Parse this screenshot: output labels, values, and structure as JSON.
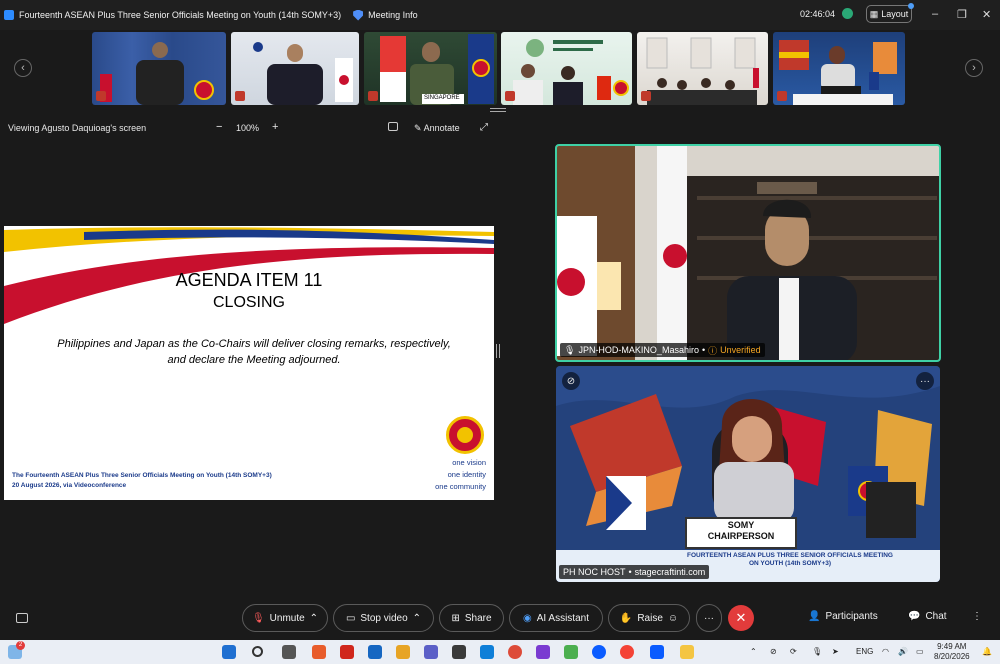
{
  "window": {
    "title": "Fourteenth ASEAN Plus Three Senior Officials Meeting on Youth (14th SOMY+3)",
    "meeting_info_label": "Meeting Info",
    "timer": "02:46:04",
    "layout_label": "Layout",
    "controls": {
      "minimize": "–",
      "restore": "❐",
      "close": "✕"
    }
  },
  "thumb_strip": {
    "prev_icon": "chevron-left-icon",
    "next_icon": "chevron-right-icon",
    "nameplate_singapore": "SINGAPORE"
  },
  "share_bar": {
    "viewing_label": "Viewing Agusto Daquioag's screen",
    "zoom_minus": "−",
    "zoom_value": "100%",
    "zoom_plus": "+",
    "annotate_label": "Annotate"
  },
  "slide": {
    "title": "AGENDA ITEM 11",
    "subtitle": "CLOSING",
    "body_line1": "Philippines and Japan as the Co-Chairs will deliver closing remarks, respectively,",
    "body_line2": "and declare the Meeting adjourned.",
    "footer_line1": "The Fourteenth ASEAN Plus Three Senior Officials Meeting on Youth (14th SOMY+3)",
    "footer_line2": "20 August 2026, via Videoconference",
    "tagline": [
      "one vision",
      "one identity",
      "one community"
    ],
    "colors": {
      "yellow": "#f2c200",
      "blue": "#1a3a8a",
      "red": "#c8102e"
    }
  },
  "videos": {
    "japan": {
      "name": "JPN-HOD-MAKINO_Masahiro",
      "status": "Unverified"
    },
    "philippines": {
      "name": "PH NOC HOST",
      "watermark": "stagecraftinti.com",
      "podium_line1": "SOMY",
      "podium_line2": "CHAIRPERSON",
      "banner_line1": "FOURTEENTH ASEAN PLUS THREE SENIOR OFFICIALS MEETING",
      "banner_line2": "ON YOUTH (14th SOMY+3)"
    }
  },
  "toolbar": {
    "unmute": "Unmute",
    "stop_video": "Stop video",
    "share": "Share",
    "ai_assistant": "AI Assistant",
    "raise": "Raise",
    "more": "···",
    "participants": "Participants",
    "chat": "Chat",
    "overflow": "⋮"
  },
  "taskbar": {
    "badge": "2",
    "lang": "ENG",
    "time": "9:49 AM",
    "date": "8/20/2026"
  }
}
